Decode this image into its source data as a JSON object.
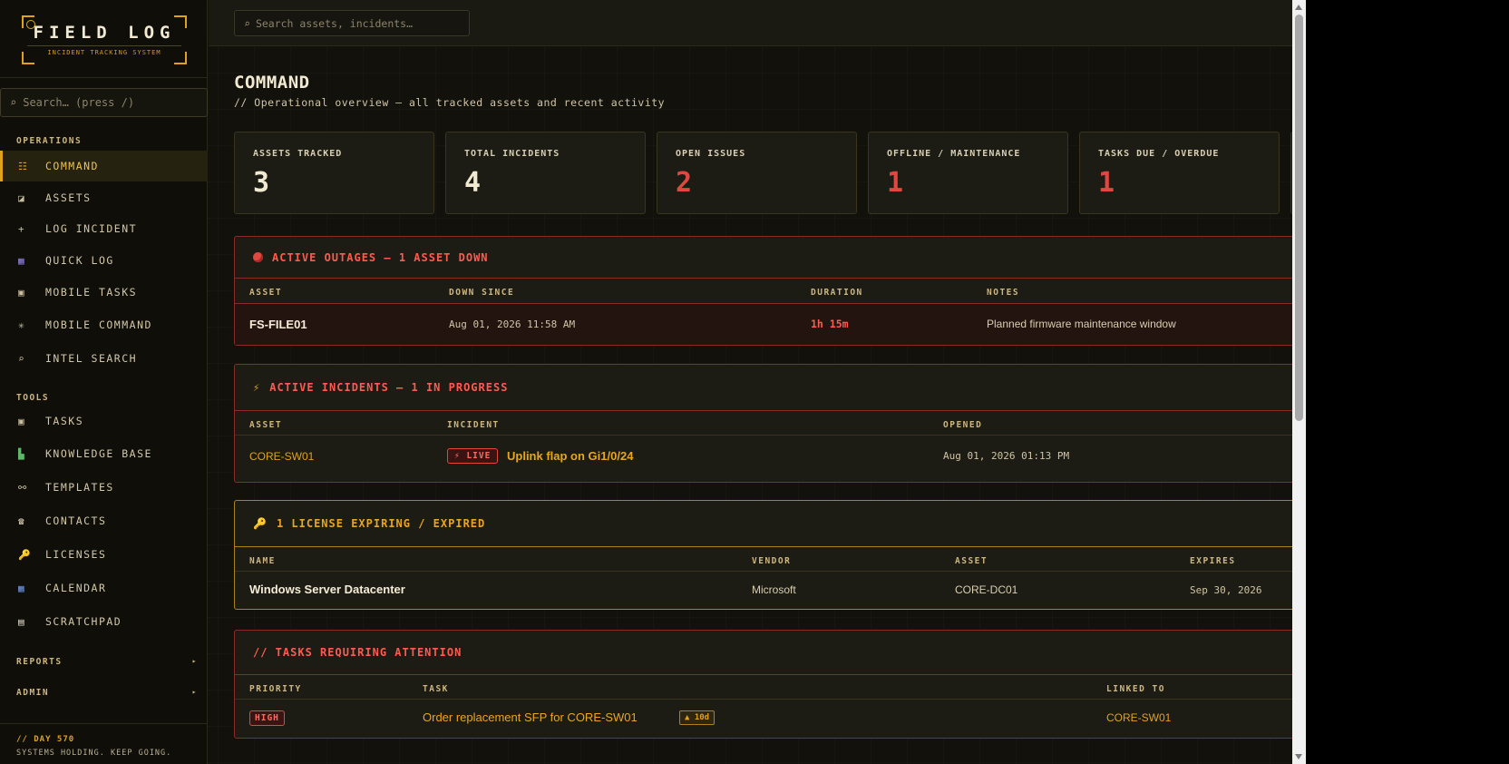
{
  "brand": {
    "title": "FIELD LOG",
    "subtitle": "INCIDENT TRACKING SYSTEM"
  },
  "sidebar": {
    "search_placeholder": "Search… (press /)",
    "sections": {
      "operations": "OPERATIONS",
      "tools": "TOOLS"
    },
    "operations": [
      {
        "icon": "☷",
        "label": "COMMAND"
      },
      {
        "icon": "◪",
        "label": "ASSETS"
      },
      {
        "icon": "+",
        "label": "LOG INCIDENT"
      },
      {
        "icon": "▦",
        "label": "QUICK LOG"
      },
      {
        "icon": "▣",
        "label": "MOBILE TASKS"
      },
      {
        "icon": "✳",
        "label": "MOBILE COMMAND"
      },
      {
        "icon": "⌕",
        "label": "INTEL SEARCH"
      }
    ],
    "tools": [
      {
        "icon": "▣",
        "label": "TASKS"
      },
      {
        "icon": "▙",
        "label": "KNOWLEDGE BASE"
      },
      {
        "icon": "⚯",
        "label": "TEMPLATES"
      },
      {
        "icon": "☎",
        "label": "CONTACTS"
      },
      {
        "icon": "🔑",
        "label": "LICENSES"
      },
      {
        "icon": "▦",
        "label": "CALENDAR"
      },
      {
        "icon": "▤",
        "label": "SCRATCHPAD"
      }
    ],
    "collapsibles": [
      {
        "label": "REPORTS",
        "arrow": "▸"
      },
      {
        "label": "ADMIN",
        "arrow": "▸"
      }
    ],
    "footer": {
      "day": "// DAY 570",
      "motto": "SYSTEMS HOLDING. KEEP GOING."
    }
  },
  "topbar": {
    "search_placeholder": "Search assets, incidents…"
  },
  "page": {
    "title": "COMMAND",
    "subtitle": "// Operational overview — all tracked assets and recent activity"
  },
  "stats": [
    {
      "label": "ASSETS TRACKED",
      "value": "3",
      "color": "#f1e9d2"
    },
    {
      "label": "TOTAL INCIDENTS",
      "value": "4",
      "color": "#f1e9d2"
    },
    {
      "label": "OPEN ISSUES",
      "value": "2",
      "color": "#e0473f"
    },
    {
      "label": "OFFLINE / MAINTENANCE",
      "value": "1",
      "color": "#e0473f"
    },
    {
      "label": "TASKS DUE / OVERDUE",
      "value": "1",
      "color": "#e0473f"
    }
  ],
  "outages": {
    "title": "ACTIVE OUTAGES — 1 ASSET DOWN",
    "columns": [
      "ASSET",
      "DOWN SINCE",
      "DURATION",
      "NOTES"
    ],
    "rows": [
      {
        "asset": "FS-FILE01",
        "down_since": "Aug 01, 2026 11:58 AM",
        "duration": "1h 15m",
        "notes": "Planned firmware maintenance window"
      }
    ]
  },
  "incidents": {
    "title": "ACTIVE INCIDENTS — 1 IN PROGRESS",
    "columns": [
      "ASSET",
      "INCIDENT",
      "OPENED"
    ],
    "rows": [
      {
        "asset": "CORE-SW01",
        "badge": "LIVE",
        "incident": "Uplink flap on Gi1/0/24",
        "opened": "Aug 01, 2026 01:13 PM"
      }
    ]
  },
  "licenses": {
    "title": "1 LICENSE EXPIRING / EXPIRED",
    "columns": [
      "NAME",
      "VENDOR",
      "ASSET",
      "EXPIRES"
    ],
    "rows": [
      {
        "name": "Windows Server Datacenter",
        "vendor": "Microsoft",
        "asset": "CORE-DC01",
        "expires": "Sep 30, 2026"
      }
    ]
  },
  "tasks": {
    "title": "// TASKS REQUIRING ATTENTION",
    "columns": [
      "PRIORITY",
      "TASK",
      "LINKED TO"
    ],
    "rows": [
      {
        "priority": "HIGH",
        "task": "Order replacement SFP for CORE-SW01",
        "overdue": "▲ 10d",
        "linked": "CORE-SW01"
      }
    ]
  },
  "colors": {
    "accent": "#e0a21a",
    "danger": "#e0473f",
    "warning": "#e0a21a"
  }
}
